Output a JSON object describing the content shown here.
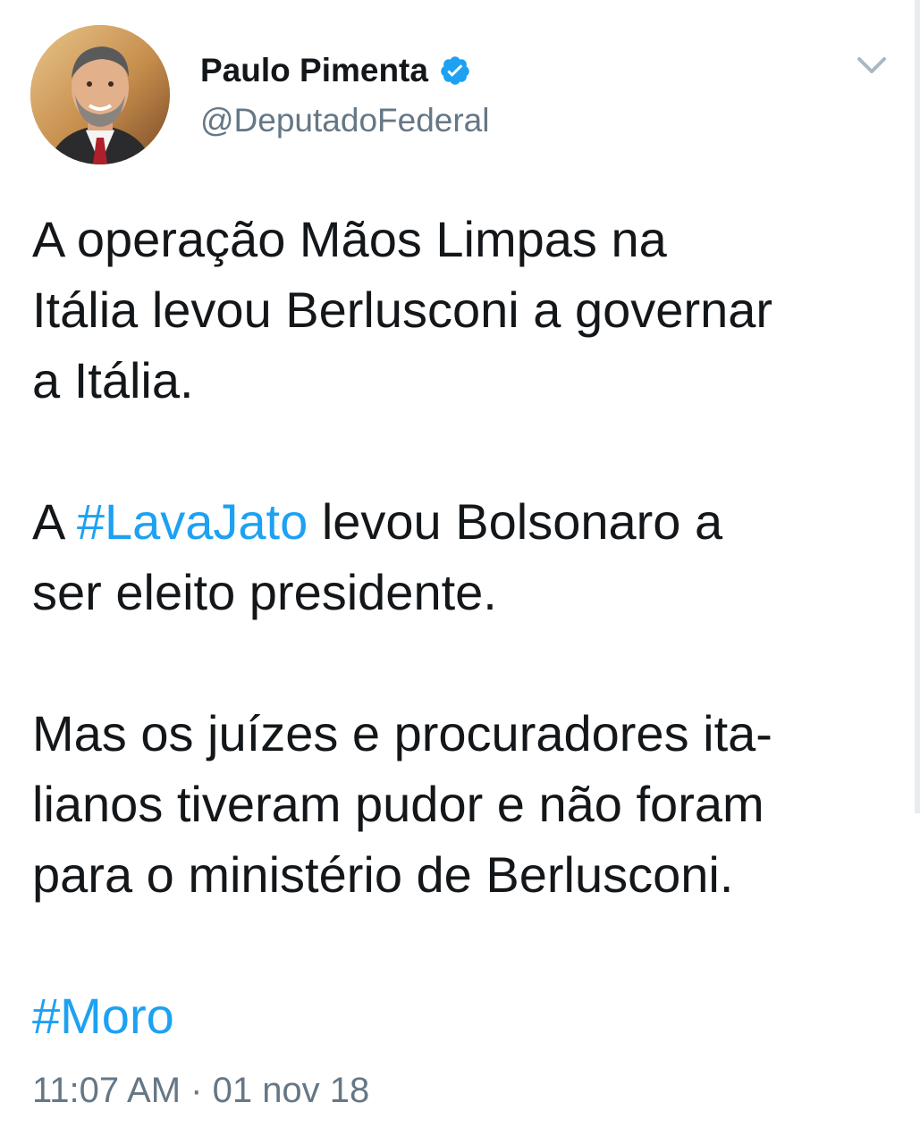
{
  "author": {
    "display_name": "Paulo Pimenta",
    "handle": "@DeputadoFederal",
    "verified": true
  },
  "icons": {
    "verified": "verified-badge-icon",
    "menu": "chevron-down-icon"
  },
  "tweet": {
    "paragraph1": "A operação Mãos Limpas na\nItália levou Berlusconi a governar\na Itália.",
    "paragraph2_prefix": "A ",
    "paragraph2_hashtag": "#LavaJato",
    "paragraph2_suffix": " levou Bolsonaro a\nser eleito presidente.",
    "paragraph3": "Mas os juízes e procuradores ita-\nlianos tiveram pudor e não foram\npara o ministério de Berlusconi.",
    "hashtag_final": "#Moro"
  },
  "timestamp": "11:07 AM · 01 nov 18",
  "colors": {
    "link": "#1da1f2",
    "text": "#14171a",
    "secondary": "#657786",
    "verified_badge": "#1da1f2"
  }
}
